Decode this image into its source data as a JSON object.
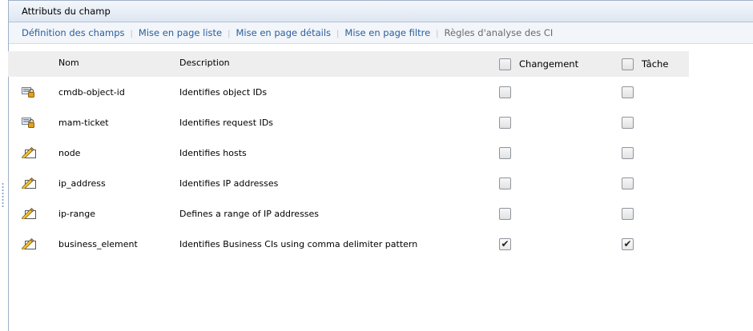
{
  "panel": {
    "title": "Attributs du champ"
  },
  "tabs": [
    {
      "label": "Définition des champs",
      "enabled": true
    },
    {
      "label": "Mise en page liste",
      "enabled": true
    },
    {
      "label": "Mise en page détails",
      "enabled": true
    },
    {
      "label": "Mise en page filtre",
      "enabled": true
    },
    {
      "label": "Règles d'analyse des CI",
      "enabled": false
    }
  ],
  "table": {
    "headers": {
      "name": "Nom",
      "description": "Description",
      "change": "Changement",
      "task": "Tâche"
    },
    "rows": [
      {
        "icon": "locked-field-icon",
        "name": "cmdb-object-id",
        "description": "Identifies object IDs",
        "change": false,
        "task": false
      },
      {
        "icon": "locked-field-icon",
        "name": "mam-ticket",
        "description": "Identifies request IDs",
        "change": false,
        "task": false
      },
      {
        "icon": "edit-field-icon",
        "name": "node",
        "description": "Identifies hosts",
        "change": false,
        "task": false
      },
      {
        "icon": "edit-field-icon",
        "name": "ip_address",
        "description": "Identifies IP addresses",
        "change": false,
        "task": false
      },
      {
        "icon": "edit-field-icon",
        "name": "ip-range",
        "description": "Defines a range of IP addresses",
        "change": false,
        "task": false
      },
      {
        "icon": "edit-field-icon",
        "name": "business_element",
        "description": "Identifies Business CIs using comma delimiter pattern",
        "change": true,
        "task": true
      }
    ]
  },
  "colors": {
    "tab_link": "#2b5f9e",
    "tab_disabled": "#6a6a6a",
    "header_bg": "#eeeeee",
    "title_bg": "#dde6f1"
  }
}
